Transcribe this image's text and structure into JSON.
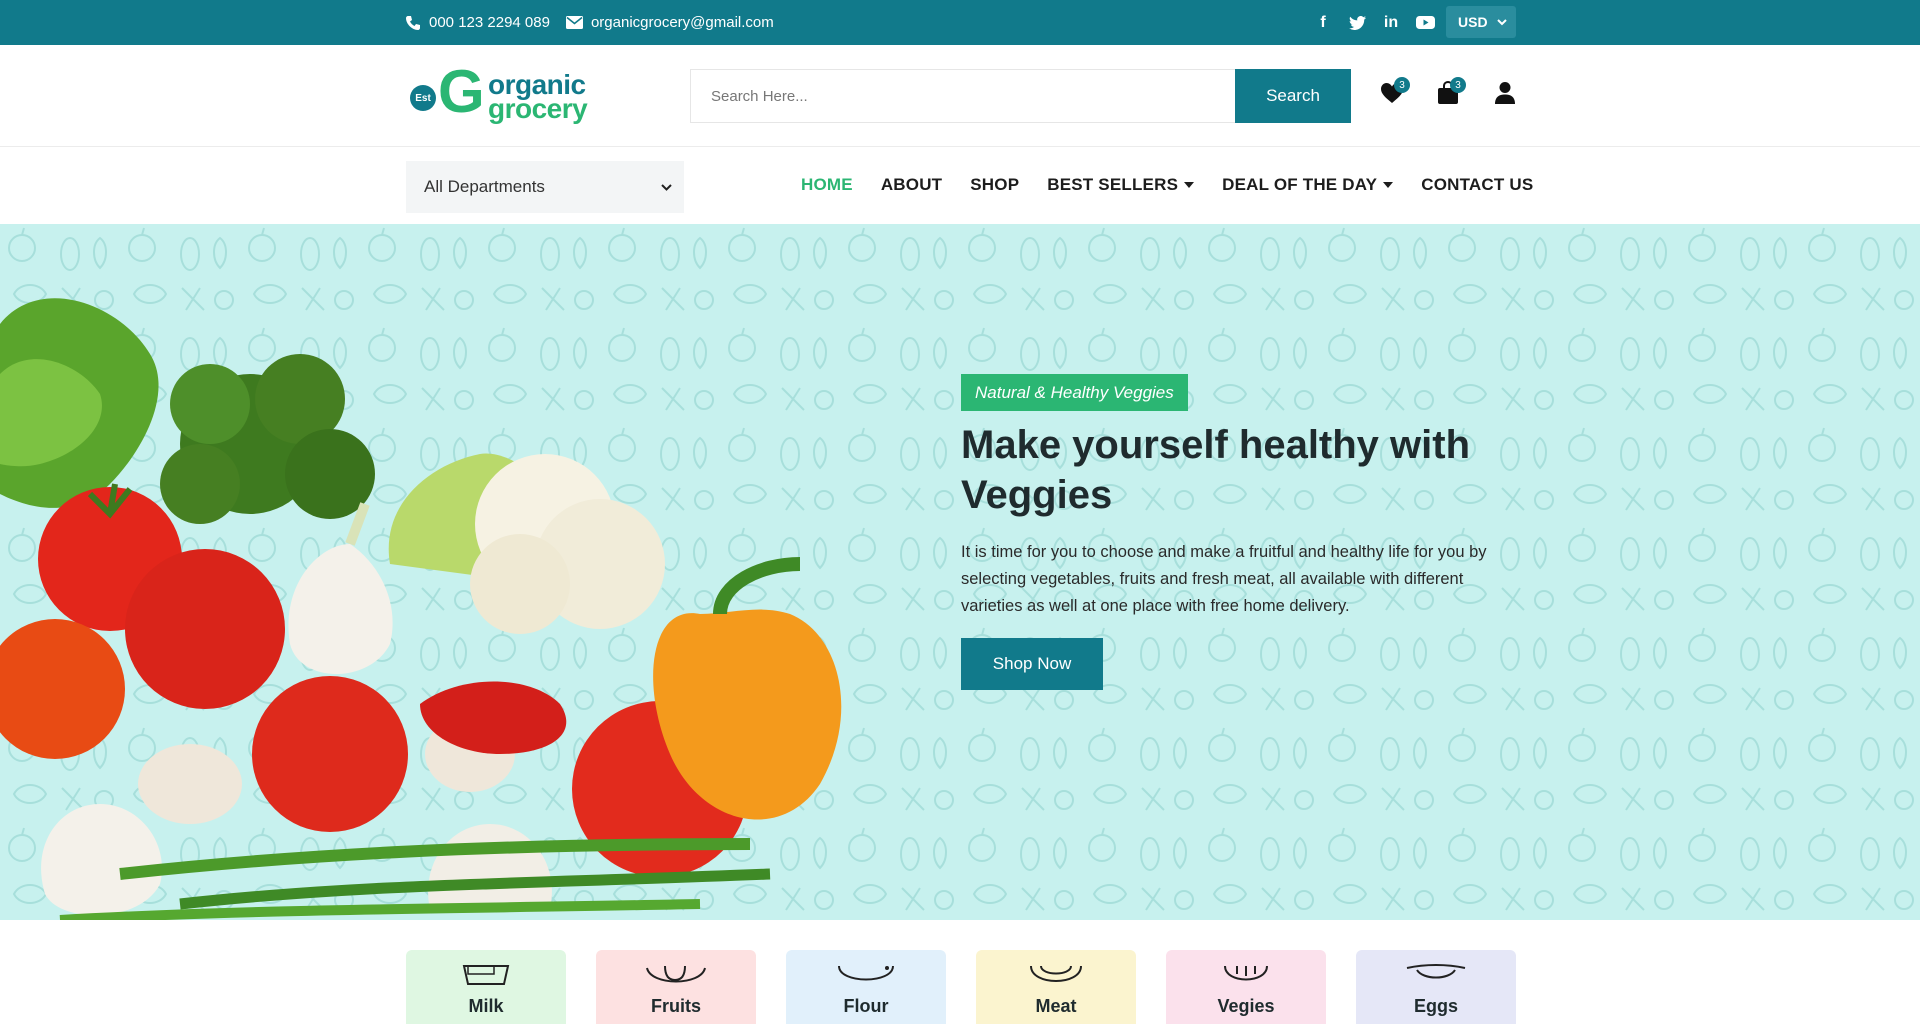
{
  "topbar": {
    "phone": "000 123 2294 089",
    "email": "organicgrocery@gmail.com",
    "social": [
      "facebook-icon",
      "twitter-icon",
      "linkedin-icon",
      "youtube-icon"
    ],
    "social_glyphs": [
      "f",
      "t",
      "in",
      "▶"
    ],
    "currency": "USD"
  },
  "header": {
    "logo_badge": "Est",
    "logo_letter": "G",
    "logo_word1": "organic",
    "logo_word2": "grocery",
    "search_placeholder": "Search Here...",
    "search_button": "Search",
    "wishlist_count": "3",
    "cart_count": "3"
  },
  "nav": {
    "department": "All Departments",
    "items": [
      {
        "label": "HOME",
        "active": true
      },
      {
        "label": "ABOUT"
      },
      {
        "label": "SHOP"
      },
      {
        "label": "BEST SELLERS",
        "dropdown": true
      },
      {
        "label": "DEAL OF THE DAY",
        "dropdown": true
      },
      {
        "label": "CONTACT US"
      }
    ]
  },
  "hero": {
    "tag": "Natural & Healthy Veggies",
    "title": "Make yourself healthy with Veggies",
    "description": "It is time for you to choose and make a fruitful and healthy life for you by selecting vegetables, fruits and fresh meat, all available with different varieties as well at one place with free home delivery.",
    "button": "Shop Now"
  },
  "categories": [
    {
      "label": "Milk",
      "color": "#dff7e2",
      "icon": "milk-icon"
    },
    {
      "label": "Fruits",
      "color": "#fde1e1",
      "icon": "fruits-icon"
    },
    {
      "label": "Flour",
      "color": "#e1f0fb",
      "icon": "flour-icon"
    },
    {
      "label": "Meat",
      "color": "#fbf4cf",
      "icon": "meat-icon"
    },
    {
      "label": "Vegies",
      "color": "#fbe1ec",
      "icon": "vegies-icon"
    },
    {
      "label": "Eggs",
      "color": "#e5e7f7",
      "icon": "eggs-icon"
    }
  ],
  "colors": {
    "primary": "#117a8b",
    "accent": "#2bb673",
    "hero_bg": "#c7f1ee"
  }
}
